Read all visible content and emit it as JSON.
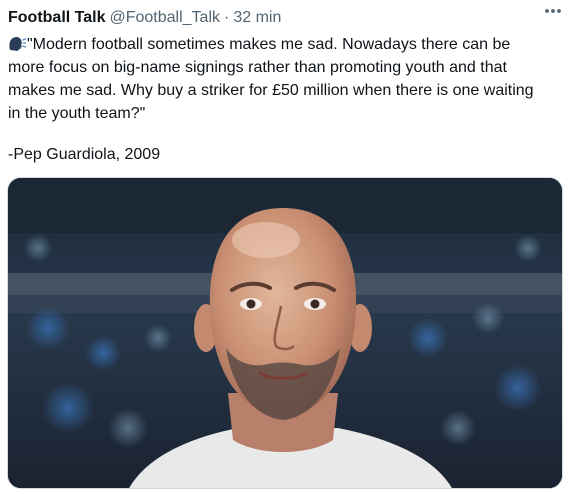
{
  "tweet": {
    "display_name": "Football Talk",
    "handle": "@Football_Talk",
    "separator": "·",
    "time": "32 min",
    "text_lines": [
      "\"Modern football sometimes makes me sad. Nowadays there can be",
      "more focus on big-name signings rather than promoting youth and that",
      "makes me sad. Why buy a striker for £50 million when there is one waiting",
      "in the youth team?\""
    ],
    "attribution": "-Pep Guardiola, 2009",
    "leading_icon": "speaking-head-icon",
    "more_icon": "more-options-icon"
  },
  "media": {
    "subject": "photo-of-bald-man-with-stubble-in-stadium"
  },
  "colors": {
    "text": "#0f1419",
    "secondary": "#536471",
    "border": "#cfd9de"
  }
}
